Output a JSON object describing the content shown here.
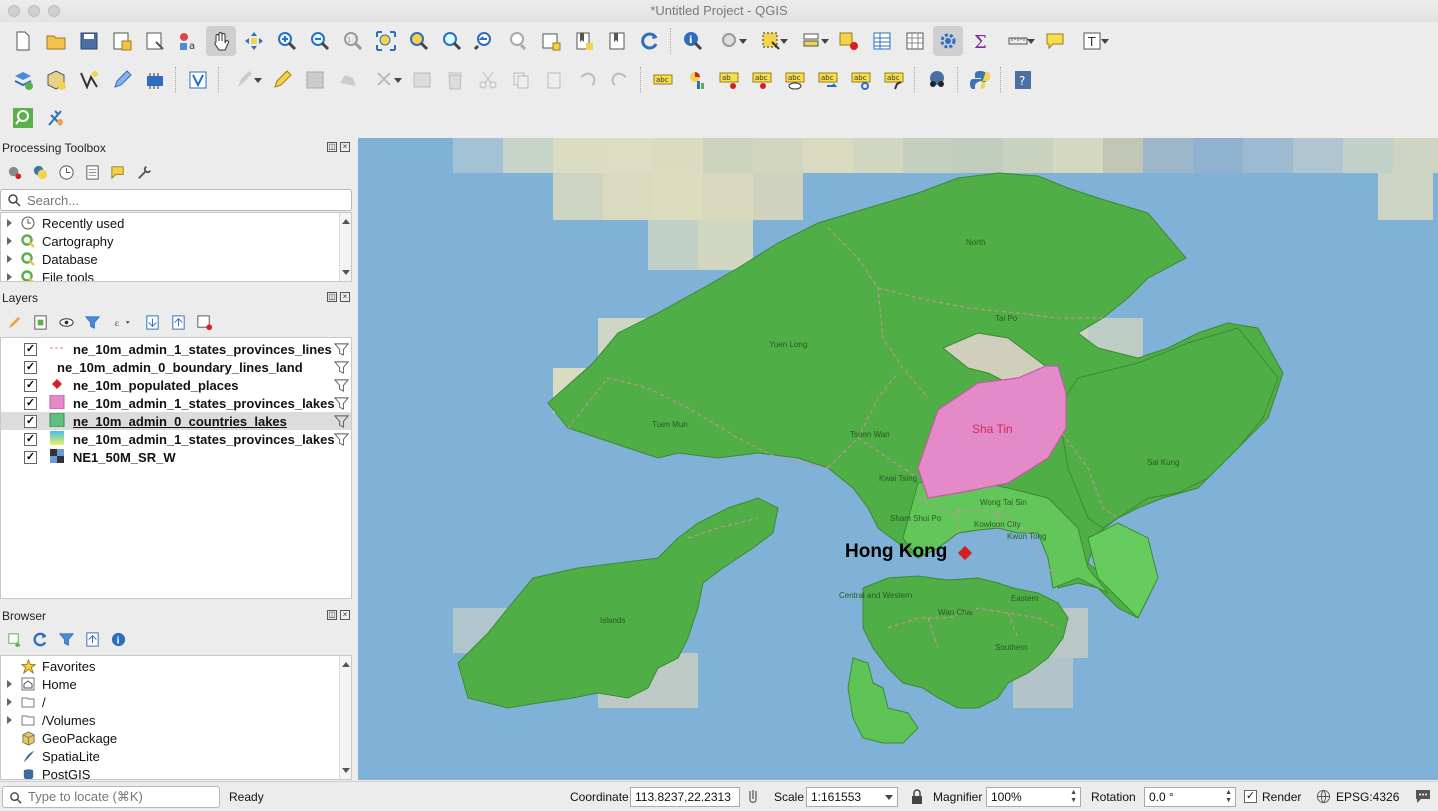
{
  "window": {
    "title": "*Untitled Project - QGIS"
  },
  "toolbar1": [
    "new-project-icon",
    "open-project-icon",
    "save-project-icon",
    "save-as-icon",
    "print-layout-icon",
    "style-manager-icon",
    "pan-icon",
    "pan-to-selection-icon",
    "zoom-in-icon",
    "zoom-out-icon",
    "zoom-native-icon",
    "zoom-full-icon",
    "zoom-to-selection-icon",
    "zoom-to-layer-icon",
    "zoom-last-icon",
    "zoom-next-icon",
    "new-map-view-icon",
    "new-bookmark-icon",
    "show-bookmarks-icon",
    "refresh-icon",
    "identify-icon",
    "run-action-icon",
    "select-features-icon",
    "select-by-value-icon",
    "deselect-icon",
    "attribute-table-icon",
    "field-calculator-icon",
    "processing-toolbox-icon",
    "statistics-icon",
    "measure-icon",
    "map-tips-icon",
    "text-annotation-icon"
  ],
  "toolbar2": [
    "data-source-manager-icon",
    "new-geopackage-layer-icon",
    "digitize-icon",
    "edit-pencil-icon",
    "gps-icon",
    "virtual-layer-icon",
    "current-edits-icon",
    "toggle-editing-icon",
    "save-edits-icon",
    "add-feature-icon",
    "vertex-tool-icon",
    "modify-attributes-icon",
    "delete-selected-icon",
    "cut-features-icon",
    "copy-features-icon",
    "paste-features-icon",
    "undo-icon",
    "redo-icon",
    "label-abc-icon",
    "diagram-icon",
    "pin-labels-icon",
    "highlight-pinned-icon",
    "show-hide-labels-icon",
    "move-label-icon",
    "rotate-label-icon",
    "change-label-icon",
    "metasearch-icon",
    "python-icon",
    "help-icon"
  ],
  "toolbar3": [
    "locator-search-icon",
    "plugin-icon"
  ],
  "processing": {
    "title": "Processing Toolbox",
    "search_placeholder": "Search...",
    "items": [
      {
        "label": "Recently used",
        "icon": "clock-icon"
      },
      {
        "label": "Cartography",
        "icon": "qgis-q-icon"
      },
      {
        "label": "Database",
        "icon": "qgis-q-icon"
      },
      {
        "label": "File tools",
        "icon": "qgis-q-icon"
      }
    ]
  },
  "layers": {
    "title": "Layers",
    "items": [
      {
        "name": "ne_10m_admin_1_states_provinces_lines",
        "symbol": "dashed-line",
        "checked": true,
        "selected": false
      },
      {
        "name": "ne_10m_admin_0_boundary_lines_land",
        "symbol": "none",
        "checked": true,
        "selected": false
      },
      {
        "name": "ne_10m_populated_places",
        "symbol": "red-diamond",
        "checked": true,
        "selected": false
      },
      {
        "name": "ne_10m_admin_1_states_provinces_lakes",
        "symbol": "pink-fill",
        "checked": true,
        "selected": false
      },
      {
        "name": "ne_10m_admin_0_countries_lakes",
        "symbol": "green-fill",
        "checked": true,
        "selected": true
      },
      {
        "name": "ne_10m_admin_1_states_provinces_lakes",
        "symbol": "gradient-fill",
        "checked": true,
        "selected": false
      },
      {
        "name": "NE1_50M_SR_W",
        "symbol": "raster",
        "checked": true,
        "selected": false
      }
    ]
  },
  "browser": {
    "title": "Browser",
    "items": [
      {
        "label": "Favorites",
        "icon": "star-icon",
        "expandable": false
      },
      {
        "label": "Home",
        "icon": "home-icon",
        "expandable": true
      },
      {
        "label": "/",
        "icon": "folder-icon",
        "expandable": true
      },
      {
        "label": "/Volumes",
        "icon": "folder-icon",
        "expandable": true
      },
      {
        "label": "GeoPackage",
        "icon": "geopackage-icon",
        "expandable": false
      },
      {
        "label": "SpatiaLite",
        "icon": "spatialite-icon",
        "expandable": false
      },
      {
        "label": "PostGIS",
        "icon": "postgis-icon",
        "expandable": false
      }
    ]
  },
  "map": {
    "labels": {
      "north": "North",
      "tai_po": "Tai Po",
      "yuen_long": "Yuen Long",
      "tuen_mun": "Tuen Mun",
      "tsuen_wan": "Tsuen Wan",
      "sha_tin": "Sha Tin",
      "sai_kung": "Sai Kung",
      "kwai_tsing": "Kwai Tsing",
      "wong_tai_sin": "Wong Tai Sin",
      "sham_shui_po": "Sham Shui Po",
      "kowloon_city": "Kowloon City",
      "kwun_tong": "Kwun Tong",
      "hong_kong": "Hong Kong",
      "central_western": "Central and Western",
      "wan_chai": "Wan Chai",
      "eastern": "Eastern",
      "southern": "Southern",
      "islands": "Islands"
    },
    "colors": {
      "sea": "#7fb2d6",
      "land_green": "#4fae46",
      "sha_tin_pink": "#e48ac8",
      "place_marker": "#d62020"
    }
  },
  "status": {
    "locator_placeholder": "Type to locate (⌘K)",
    "ready": "Ready",
    "coordinate_label": "Coordinate",
    "coordinate_value": "113.8237,22.2313",
    "scale_label": "Scale",
    "scale_value": "1:161553",
    "magnifier_label": "Magnifier",
    "magnifier_value": "100%",
    "rotation_label": "Rotation",
    "rotation_value": "0.0 °",
    "render_label": "Render",
    "crs": "EPSG:4326"
  }
}
